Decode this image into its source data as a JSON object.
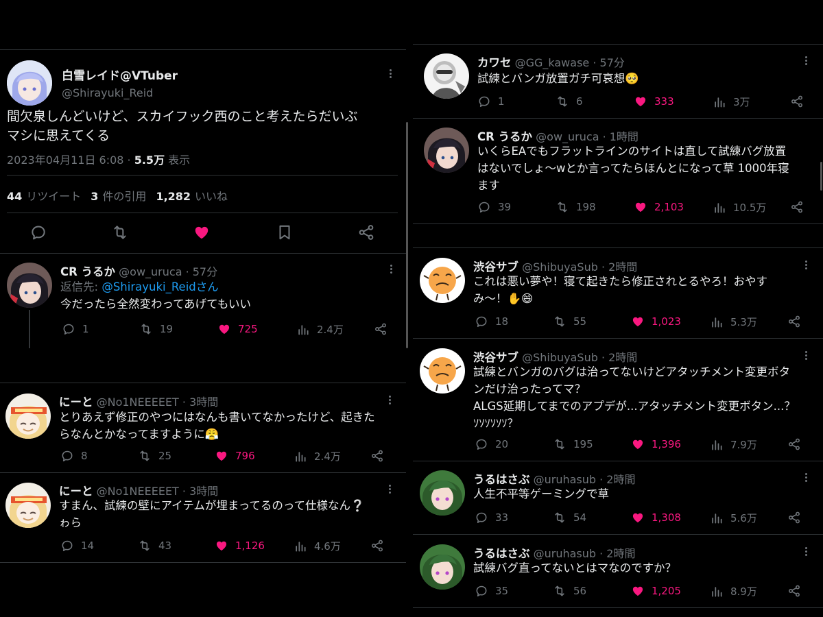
{
  "colors": {
    "bg": "#000000",
    "text": "#e7e9ea",
    "muted": "#71767b",
    "link": "#1d9bf0",
    "like": "#f91880",
    "divider": "#2f3336"
  },
  "main_tweet": {
    "name": "白雪レイド@VTuber",
    "handle": "@Shirayuki_Reid",
    "text_line1": "間欠泉しんどいけど、スカイフック西のこと考えたらだいぶ",
    "text_line2": "マシに思えてくる",
    "datetime": "2023年04月11日 6:08 · ",
    "views": "5.5万",
    "views_label": " 表示",
    "retweets": "44",
    "retweets_label": "リツイート",
    "quotes": "3",
    "quotes_label": "件の引用",
    "likes": "1,282",
    "likes_label": "いいね",
    "icons": [
      "reply-icon",
      "retweet-icon",
      "like-icon-filled",
      "bookmark-icon",
      "share-icon"
    ]
  },
  "left_replies": [
    {
      "name": "CR うるか",
      "handle": "@ow_uruca · 57分",
      "replying_label": "返信先: ",
      "replying_to": "@Shirayuki_Reidさん",
      "lines": [
        "今だったら全然変わってあげてもいい"
      ],
      "replies": "1",
      "retweets": "19",
      "likes": "725",
      "views": "2.4万"
    },
    {
      "name": "にーと",
      "handle": "@No1NEEEEET · 3時間",
      "lines": [
        "とりあえず修正のやつにはなんも書いてなかったけど、起きた",
        "らなんとかなってますように😤"
      ],
      "replies": "8",
      "retweets": "25",
      "likes": "796",
      "views": "2.4万"
    },
    {
      "name": "にーと",
      "handle": "@No1NEEEEET · 3時間",
      "lines": [
        "すまん、試練の壁にアイテムが埋まってるのって仕様なん❔",
        "ゎら"
      ],
      "replies": "14",
      "retweets": "43",
      "likes": "1,126",
      "views": "4.6万"
    }
  ],
  "right_replies": [
    {
      "name": "カワセ",
      "handle": "@GG_kawase · 57分",
      "lines": [
        "試練とバンガ放置ガチ可哀想🥺"
      ],
      "replies": "1",
      "retweets": "6",
      "likes": "333",
      "views": "3万"
    },
    {
      "name": "CR うるか",
      "handle": "@ow_uruca · 1時間",
      "lines": [
        "いくらEAでもフラットラインのサイトは直して試練バグ放置",
        "はないでしょ〜wとか言ってたらほんとになって草 1000年寝",
        "ます"
      ],
      "replies": "39",
      "retweets": "198",
      "likes": "2,103",
      "views": "10.5万"
    },
    {
      "name": "渋谷サブ",
      "handle": "@ShibuyaSub · 2時間",
      "lines": [
        "これは悪い夢や！寝て起きたら修正されとるやろ！おやす",
        "み〜！✋😄"
      ],
      "replies": "18",
      "retweets": "55",
      "likes": "1,023",
      "views": "5.3万"
    },
    {
      "name": "渋谷サブ",
      "handle": "@ShibuyaSub · 2時間",
      "lines": [
        "試練とバンガのバグは治ってないけどアタッチメント変更ボタ",
        "ンだけ治ったってマ？",
        "ALGS延期してまでのアプデが...アタッチメント変更ボタン...？",
        "ｿｿｿｿｿｿ？"
      ],
      "replies": "20",
      "retweets": "195",
      "likes": "1,396",
      "views": "7.9万"
    },
    {
      "name": "うるはさぶ",
      "handle": "@uruhasub · 2時間",
      "lines": [
        "人生不平等ゲーミングで草"
      ],
      "replies": "33",
      "retweets": "54",
      "likes": "1,308",
      "views": "5.6万"
    },
    {
      "name": "うるはさぶ",
      "handle": "@uruhasub · 2時間",
      "lines": [
        "試練バグ直ってないとはマなのですか？"
      ],
      "replies": "35",
      "retweets": "56",
      "likes": "1,205",
      "views": "8.9万"
    }
  ]
}
